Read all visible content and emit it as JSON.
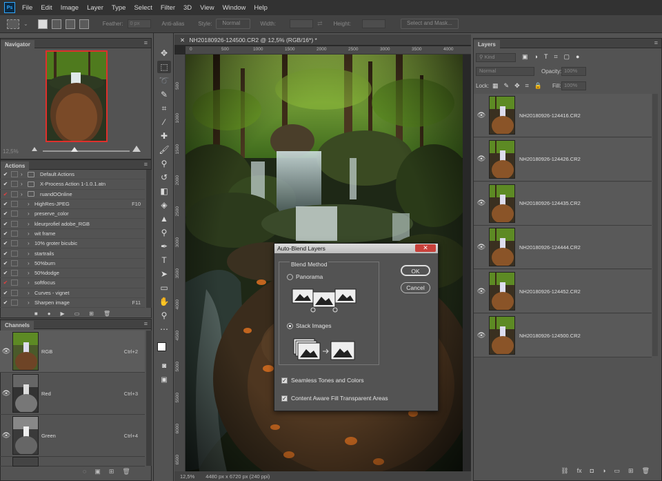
{
  "menubar": {
    "logo": "Ps",
    "items": [
      "File",
      "Edit",
      "Image",
      "Layer",
      "Type",
      "Select",
      "Filter",
      "3D",
      "View",
      "Window",
      "Help"
    ]
  },
  "options": {
    "feather_label": "Feather:",
    "feather_value": "0 px",
    "antialias_label": "Anti-alias",
    "style_label": "Style:",
    "style_value": "Normal",
    "width_label": "Width:",
    "height_label": "Height:",
    "select_mask": "Select and Mask..."
  },
  "navigator": {
    "title": "Navigator",
    "zoom": "12,5%"
  },
  "actions": {
    "title": "Actions",
    "rows": [
      {
        "label": "Default Actions",
        "key": "",
        "check": "✔",
        "red": false,
        "level": 0
      },
      {
        "label": "X-Process Action 1-1.0.1.atn",
        "key": "",
        "check": "✔",
        "red": false,
        "level": 0
      },
      {
        "label": "ruandOOnline",
        "key": "",
        "check": "✔",
        "red": true,
        "level": 0
      },
      {
        "label": "HighRes-JPEG",
        "key": "F10",
        "check": "✔",
        "red": false,
        "level": 1
      },
      {
        "label": "preserve_color",
        "key": "",
        "check": "✔",
        "red": false,
        "level": 1
      },
      {
        "label": "kleurprofiel adobe_RGB",
        "key": "",
        "check": "✔",
        "red": false,
        "level": 1
      },
      {
        "label": "wit frame",
        "key": "",
        "check": "✔",
        "red": false,
        "level": 1
      },
      {
        "label": "10% groter bicubic",
        "key": "",
        "check": "✔",
        "red": false,
        "level": 1
      },
      {
        "label": "startrails",
        "key": "",
        "check": "✔",
        "red": false,
        "level": 1
      },
      {
        "label": "50%burn",
        "key": "",
        "check": "✔",
        "red": false,
        "level": 1
      },
      {
        "label": "50%dodge",
        "key": "",
        "check": "✔",
        "red": false,
        "level": 1
      },
      {
        "label": "softfocus",
        "key": "",
        "check": "✔",
        "red": true,
        "level": 1
      },
      {
        "label": "Curves - vignet",
        "key": "",
        "check": "✔",
        "red": false,
        "level": 1
      },
      {
        "label": "Sharpen image",
        "key": "F11",
        "check": "✔",
        "red": false,
        "level": 1
      }
    ]
  },
  "channels": {
    "title": "Channels",
    "rows": [
      {
        "name": "RGB",
        "shortcut": "Ctrl+2"
      },
      {
        "name": "Red",
        "shortcut": "Ctrl+3"
      },
      {
        "name": "Green",
        "shortcut": "Ctrl+4"
      }
    ]
  },
  "document": {
    "tab": "NH20180926-124500.CR2 @ 12,5% (RGB/16*) *",
    "close_glyph": "✕",
    "ruler_h": [
      "0",
      "500",
      "1000",
      "1500",
      "2000",
      "2500",
      "3000",
      "3500",
      "4000"
    ],
    "ruler_v": [
      "500",
      "1000",
      "1500",
      "2000",
      "2500",
      "3000",
      "3500",
      "4000",
      "4500",
      "5000",
      "5500",
      "6000",
      "6500"
    ],
    "zoom": "12,5%",
    "dimensions": "4480 px x 6720 px (240 ppi)"
  },
  "dialog": {
    "title": "Auto-Blend Layers",
    "blend_method": "Blend Method",
    "panorama": "Panorama",
    "stack_images": "Stack Images",
    "ok": "OK",
    "cancel": "Cancel",
    "seamless": "Seamless Tones and Colors",
    "content_aware": "Content Aware Fill Transparent Areas",
    "selected_method": "Stack Images"
  },
  "layers": {
    "title": "Layers",
    "search_placeholder": "Kind",
    "blend_mode": "Normal",
    "opacity_label": "Opacity:",
    "opacity_value": "100%",
    "lock_label": "Lock:",
    "fill_label": "Fill:",
    "fill_value": "100%",
    "rows": [
      {
        "name": "NH20180926-124416.CR2"
      },
      {
        "name": "NH20180926-124426.CR2"
      },
      {
        "name": "NH20180926-124435.CR2"
      },
      {
        "name": "NH20180926-124444.CR2"
      },
      {
        "name": "NH20180926-124452.CR2"
      },
      {
        "name": "NH20180926-124500.CR2"
      }
    ]
  }
}
